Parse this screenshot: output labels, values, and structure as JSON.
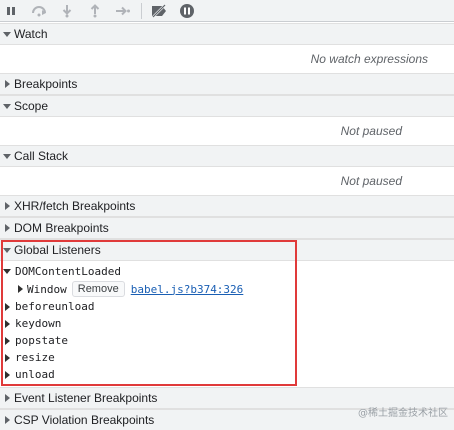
{
  "toolbar": {
    "buttons": [
      {
        "icon": "pause-script-icon"
      },
      {
        "icon": "step-over-icon"
      },
      {
        "icon": "step-into-icon"
      },
      {
        "icon": "step-out-icon"
      },
      {
        "icon": "step-icon"
      },
      {
        "icon": "deactivate-breakpoints-icon"
      },
      {
        "icon": "pause-on-exceptions-icon"
      }
    ]
  },
  "panes": {
    "watch": {
      "title": "Watch",
      "placeholder": "No watch expressions"
    },
    "breakpoints": {
      "title": "Breakpoints"
    },
    "scope": {
      "title": "Scope",
      "placeholder": "Not paused"
    },
    "call_stack": {
      "title": "Call Stack",
      "placeholder": "Not paused"
    },
    "xhr": {
      "title": "XHR/fetch Breakpoints"
    },
    "dom": {
      "title": "DOM Breakpoints"
    },
    "global_listeners": {
      "title": "Global Listeners",
      "events": [
        {
          "name": "DOMContentLoaded",
          "expanded": true
        },
        {
          "name": "beforeunload"
        },
        {
          "name": "keydown"
        },
        {
          "name": "popstate"
        },
        {
          "name": "resize"
        },
        {
          "name": "unload"
        }
      ],
      "listener": {
        "target": "Window",
        "remove_label": "Remove",
        "source": "babel.js?b374:326"
      }
    },
    "event_listener": {
      "title": "Event Listener Breakpoints"
    },
    "csp": {
      "title": "CSP Violation Breakpoints"
    }
  },
  "watermark": "@稀土掘金技术社区",
  "colors": {
    "highlight": "#e03a3a",
    "link": "#1a5fb4",
    "header_bg": "#f1f3f4"
  }
}
